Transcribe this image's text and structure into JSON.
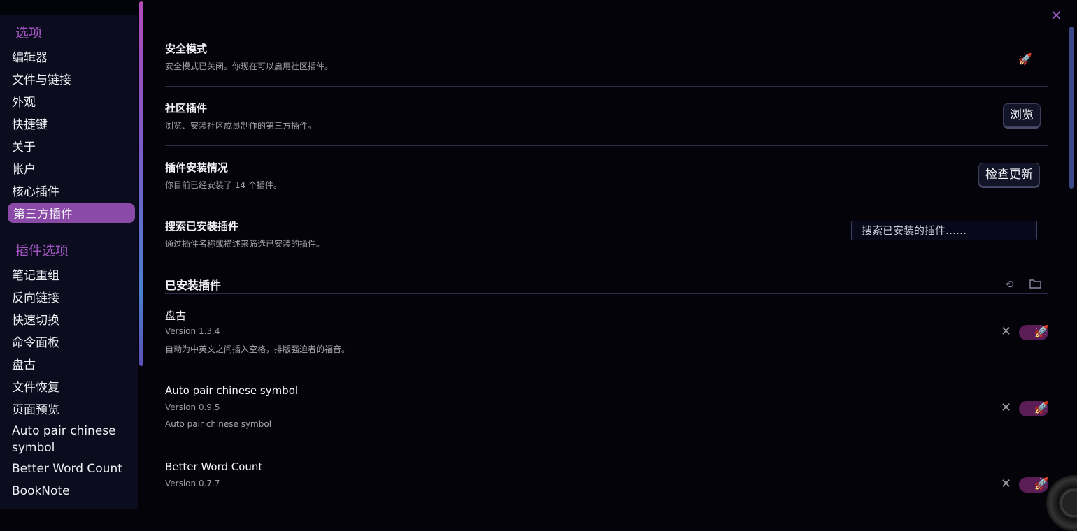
{
  "sidebar": {
    "options_header": "选项",
    "options": [
      "编辑器",
      "文件与链接",
      "外观",
      "快捷键",
      "关于",
      "帐户",
      "核心插件",
      "第三方插件"
    ],
    "plugin_options_header": "插件选项",
    "plugin_options": [
      "笔记重组",
      "反向链接",
      "快速切换",
      "命令面板",
      "盘古",
      "文件恢复",
      "页面预览",
      "Auto pair chinese symbol",
      "Better Word Count",
      "BookNote"
    ]
  },
  "settings": {
    "safe_mode": {
      "title": "安全模式",
      "desc": "安全模式已关闭。你现在可以启用社区插件。"
    },
    "community": {
      "title": "社区插件",
      "desc": "浏览、安装社区成员制作的第三方插件。",
      "button": "浏览"
    },
    "install_status": {
      "title": "插件安装情况",
      "desc": "你目前已经安装了 14 个插件。",
      "button": "检查更新"
    },
    "search": {
      "title": "搜索已安装插件",
      "desc": "通过插件名称或描述来筛选已安装的插件。",
      "placeholder": "搜索已安装的插件……"
    }
  },
  "installed": {
    "title": "已安装插件",
    "plugins": [
      {
        "name": "盘古",
        "version": "Version 1.3.4",
        "desc": "自动为中英文之间插入空格，排版强迫者的福音。",
        "enabled": true
      },
      {
        "name": "Auto pair chinese symbol",
        "version": "Version 0.9.5",
        "desc": "Auto pair chinese symbol",
        "enabled": true
      },
      {
        "name": "Better Word Count",
        "version": "Version 0.7.7",
        "desc": "",
        "enabled": true
      }
    ]
  },
  "icons": {
    "close": "close-icon",
    "reload": "reload-icon",
    "folder": "folder-icon",
    "rocket": "rocket-icon",
    "remove": "x-icon"
  },
  "colors": {
    "accent": "#8b4aa8",
    "toggle_on": "#5a1d55",
    "section_header": "#a457c4"
  }
}
